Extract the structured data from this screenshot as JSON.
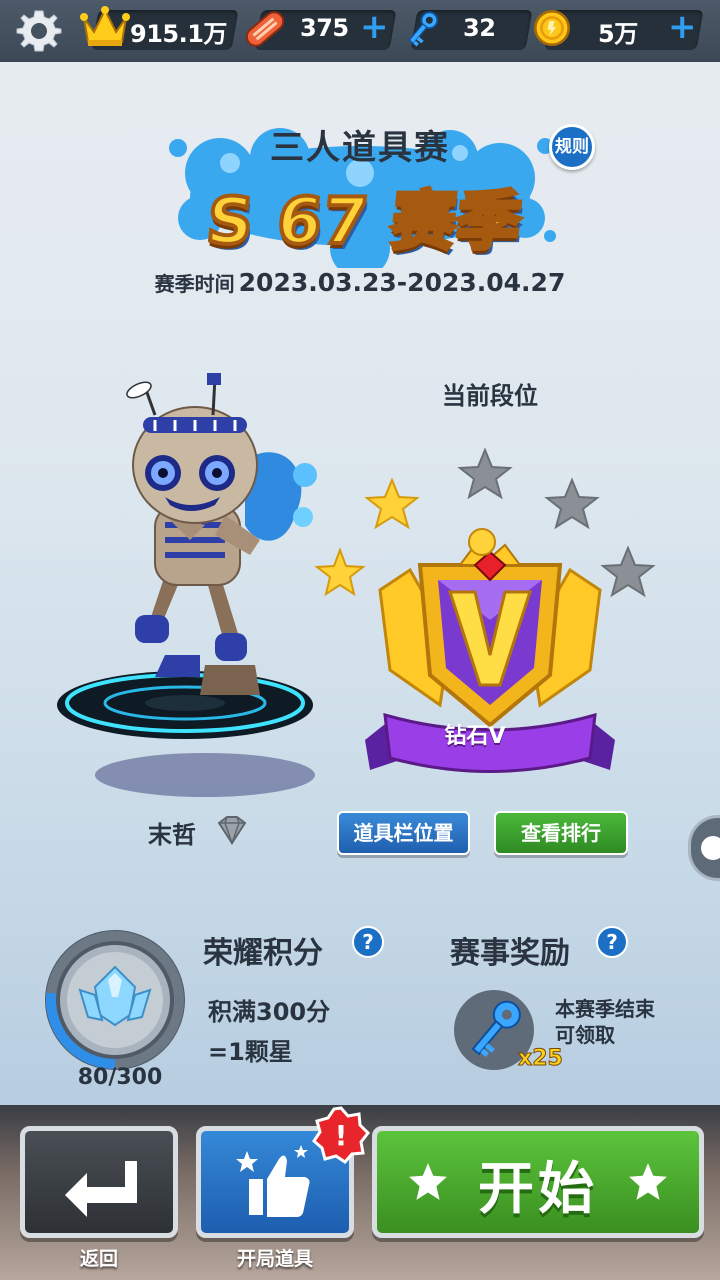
{
  "topbar": {
    "crowns": "915.1万",
    "boards": "375",
    "keys": "32",
    "coins": "5万",
    "plus": "+"
  },
  "header": {
    "title": "三人道具赛",
    "season": "S 67 赛季",
    "rules_label": "规则",
    "season_time_label": "赛季时间",
    "season_time_value": "2023.03.23-2023.04.27"
  },
  "rank": {
    "label": "当前段位",
    "name": "钻石V",
    "stars_filled": 2,
    "stars_total": 5
  },
  "player": {
    "name": "末哲"
  },
  "buttons": {
    "item_slot": "道具栏位置",
    "leaderboard": "查看排行"
  },
  "honor": {
    "title": "荣耀积分",
    "help": "?",
    "desc_line1": "积满300分",
    "desc_line2": "=1颗星",
    "progress_text": "80/300",
    "progress_fraction": 0.267
  },
  "reward": {
    "title": "赛事奖励",
    "help": "?",
    "count": "x25",
    "desc_line1": "本赛季结束",
    "desc_line2": "可领取"
  },
  "bottom": {
    "back_label": "返回",
    "items_label": "开局道具",
    "alert": "!",
    "start_label": "开始"
  },
  "colors": {
    "accent_blue": "#1b6fc4",
    "start_green": "#4ab83a",
    "gold": "#ffd23a",
    "rank_purple": "#8a3ad0"
  }
}
